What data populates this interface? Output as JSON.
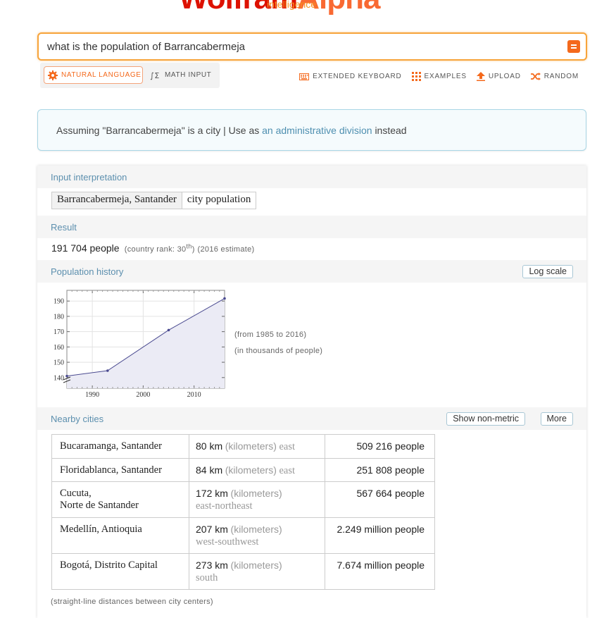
{
  "header": {
    "logo_text_a": "Wolfram",
    "logo_text_b": "Alpha",
    "tagline": "intelligence.",
    "logo_color": "#dd1100"
  },
  "search": {
    "value": "what is the population of Barrancabermeja",
    "placeholder": ""
  },
  "modes": {
    "natural_label": "NATURAL LANGUAGE",
    "math_label": "MATH INPUT"
  },
  "toolbar": {
    "keyboard_label": "EXTENDED KEYBOARD",
    "examples_label": "EXAMPLES",
    "upload_label": "UPLOAD",
    "random_label": "RANDOM"
  },
  "assumption": {
    "prefix": "Assuming \"Barrancabermeja\" is a city | Use as",
    "link": "an administrative division",
    "suffix": "instead"
  },
  "pods": {
    "input_title": "Input interpretation",
    "input_cells": [
      "Barrancabermeja, Santander",
      "city population"
    ],
    "result_title": "Result",
    "result_value": "191 704 people",
    "result_rank_prefix": "(country rank: 30",
    "result_rank_sup": "th",
    "result_rank_suffix": ")",
    "result_estimate": "(2016 estimate)",
    "history_title": "Population history",
    "log_scale_label": "Log scale",
    "history_note_range": "(from 1985 to 2016)",
    "history_note_units": "(in thousands of people)",
    "nearby_title": "Nearby cities",
    "show_nonmetric_label": "Show non-metric",
    "more_label": "More",
    "footnote": "(straight-line distances between city centers)"
  },
  "chart_data": {
    "type": "area",
    "x": [
      1985,
      1993,
      2005,
      2016
    ],
    "y": [
      141,
      144.5,
      171,
      191.7
    ],
    "xlim": [
      1985,
      2016
    ],
    "ylim": [
      133,
      197
    ],
    "xticks": [
      "1990",
      "2000",
      "2010"
    ],
    "yticks": [
      "140",
      "150",
      "160",
      "170",
      "180",
      "190"
    ],
    "grid": true
  },
  "cities": [
    {
      "name": [
        "Bucaramanga, Santander"
      ],
      "dist": "80 km",
      "unit": "(kilometers)",
      "dir": "east",
      "pop": "509 216 people"
    },
    {
      "name": [
        "Floridablanca, Santander"
      ],
      "dist": "84 km",
      "unit": "(kilometers)",
      "dir": "east",
      "pop": "251 808 people"
    },
    {
      "name": [
        "Cucuta,",
        "Norte de Santander"
      ],
      "dist": "172 km",
      "unit": "(kilometers)",
      "dir": "east-northeast",
      "pop": "567 664 people"
    },
    {
      "name": [
        "Medellín, Antioquia"
      ],
      "dist": "207 km",
      "unit": "(kilometers)",
      "dir": "west-southwest",
      "pop": "2.249 million people"
    },
    {
      "name": [
        "Bogotá, Distrito Capital"
      ],
      "dist": "273 km",
      "unit": "(kilometers)",
      "dir": "south",
      "pop": "7.674 million people"
    }
  ]
}
